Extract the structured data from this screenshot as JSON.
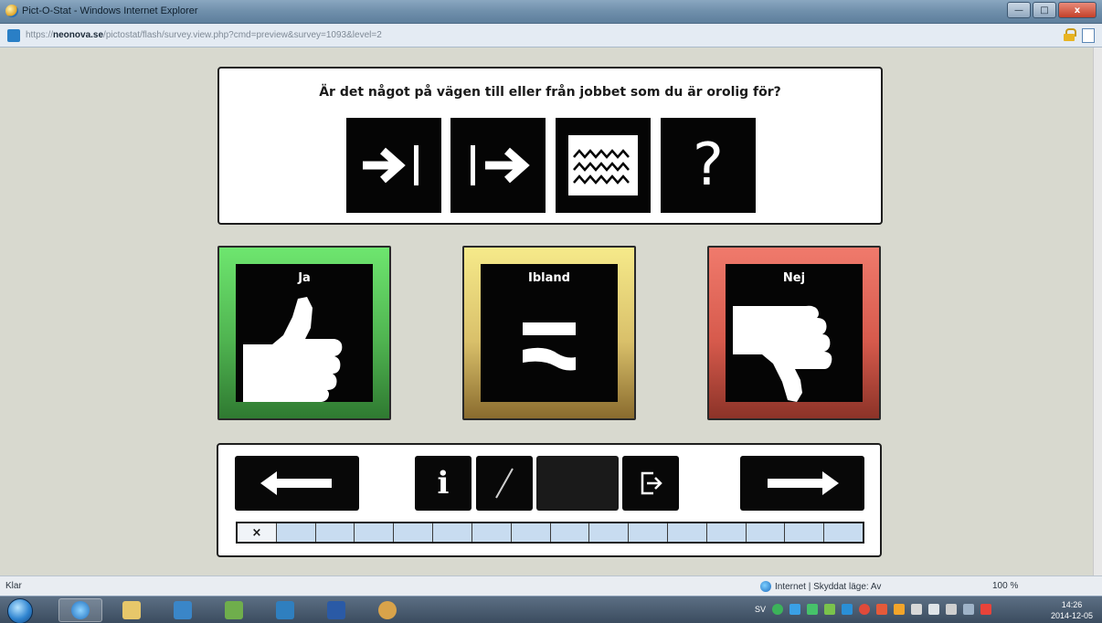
{
  "window": {
    "title": "Pict-O-Stat - Windows Internet Explorer",
    "minimize": "—",
    "maximize": "□",
    "close": "x"
  },
  "address": {
    "prefix": "https://",
    "host": "neonova.se",
    "path": "/pictostat/flash/survey.view.php?cmd=preview&survey=1093&level=2"
  },
  "question": {
    "text": "Är det något på vägen till eller från jobbet som du är orolig för?",
    "pictograms": [
      "arrow-to-bar-icon",
      "bar-to-arrow-icon",
      "water-waves-icon",
      "question-mark-icon"
    ],
    "question_mark": "?"
  },
  "answers": {
    "yes": {
      "label": "Ja",
      "icon": "thumbs-up-icon",
      "color": "#4fb350"
    },
    "sometimes": {
      "label": "Ibland",
      "icon": "approximately-equal-icon",
      "color": "#d9c06a"
    },
    "no": {
      "label": "Nej",
      "icon": "thumbs-down-icon",
      "color": "#d65a4c"
    }
  },
  "navigation": {
    "prev_icon": "arrow-left-icon",
    "info_label": "i",
    "pen_label": "/",
    "exit_icon": "exit-icon",
    "next_icon": "arrow-right-icon"
  },
  "progress": {
    "total": 16,
    "current": 1,
    "current_mark": "×"
  },
  "status": {
    "left": "Klar",
    "zone": "Internet | Skyddat läge: Av",
    "zoom": "100 %"
  },
  "taskbar": {
    "lang": "SV",
    "time": "14:26",
    "date": "2014-12-05"
  }
}
